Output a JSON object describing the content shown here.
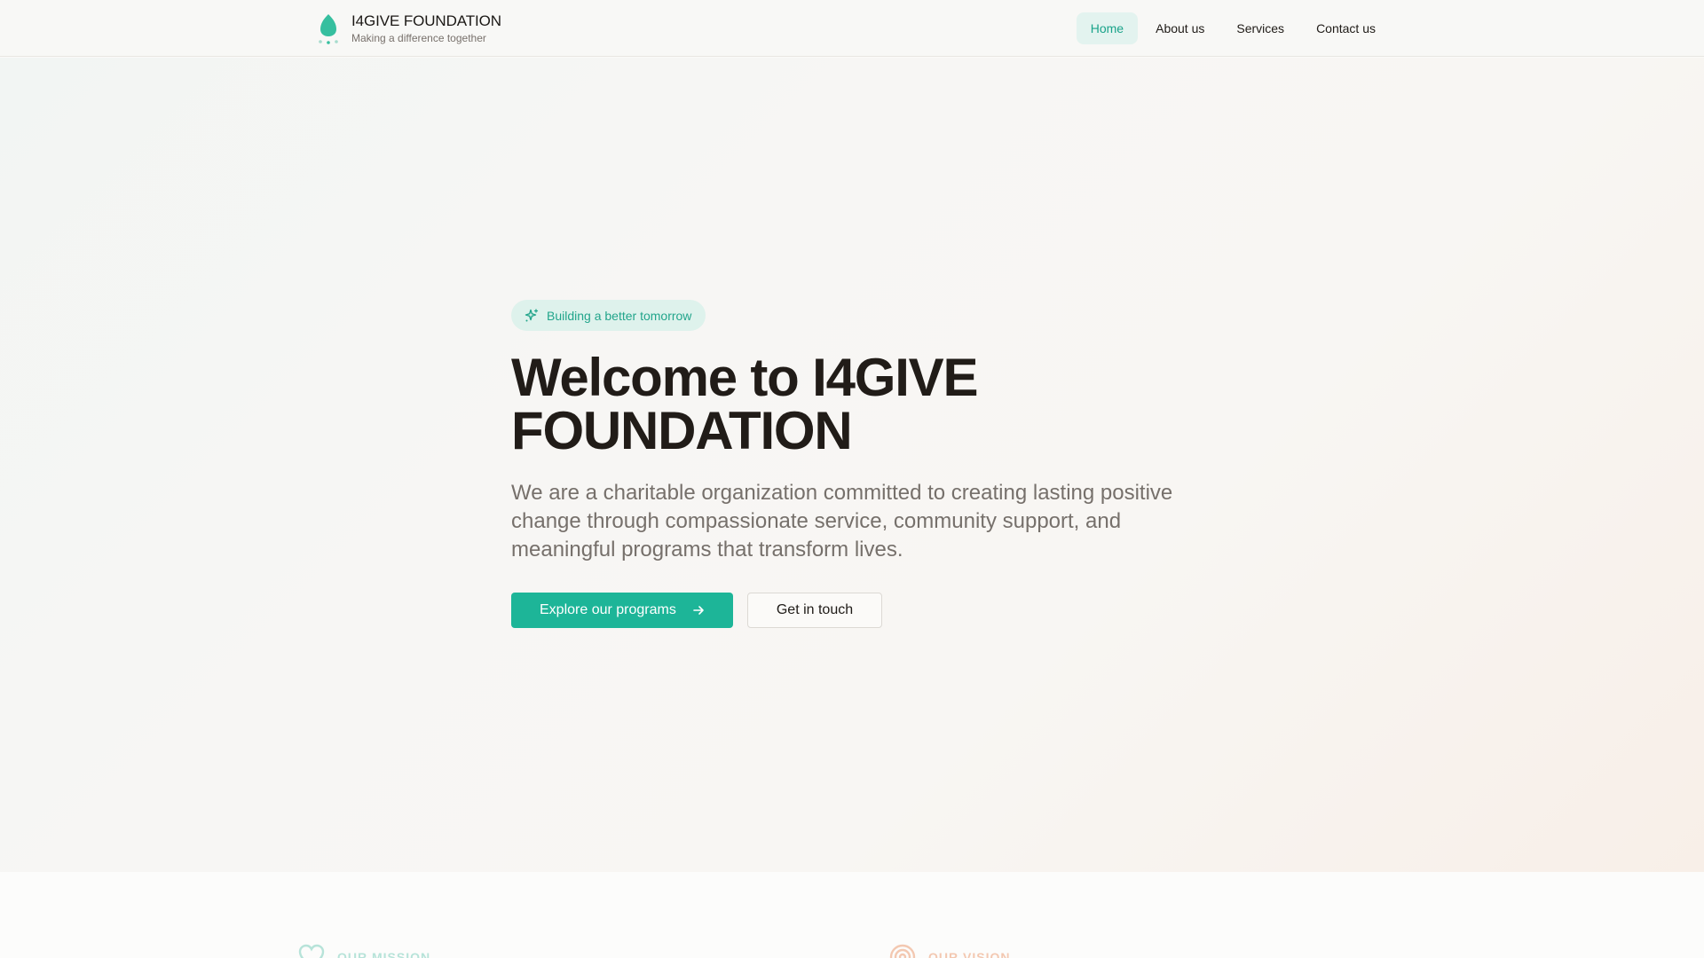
{
  "brand": {
    "title": "I4GIVE FOUNDATION",
    "tagline": "Making a difference together",
    "icon": "leaf-drop-icon"
  },
  "nav": {
    "items": [
      {
        "label": "Home",
        "active": true
      },
      {
        "label": "About us",
        "active": false
      },
      {
        "label": "Services",
        "active": false
      },
      {
        "label": "Contact us",
        "active": false
      }
    ]
  },
  "hero": {
    "badge": "Building a better tomorrow",
    "badge_icon": "sparkle-icon",
    "title": "Welcome to I4GIVE FOUNDATION",
    "description": "We are a charitable organization committed to creating lasting positive change through compassionate service, community support, and meaningful programs that transform lives.",
    "primary_button": "Explore our programs",
    "secondary_button": "Get in touch"
  },
  "sections": {
    "mission": {
      "label": "OUR MISSION",
      "icon": "heart-icon"
    },
    "vision": {
      "label": "OUR VISION",
      "icon": "target-icon"
    }
  },
  "colors": {
    "accent": "#1db598",
    "accent_light": "#e3f3ef",
    "text": "#211c18",
    "muted": "#76706b",
    "vision_accent": "#f3c8b1"
  }
}
